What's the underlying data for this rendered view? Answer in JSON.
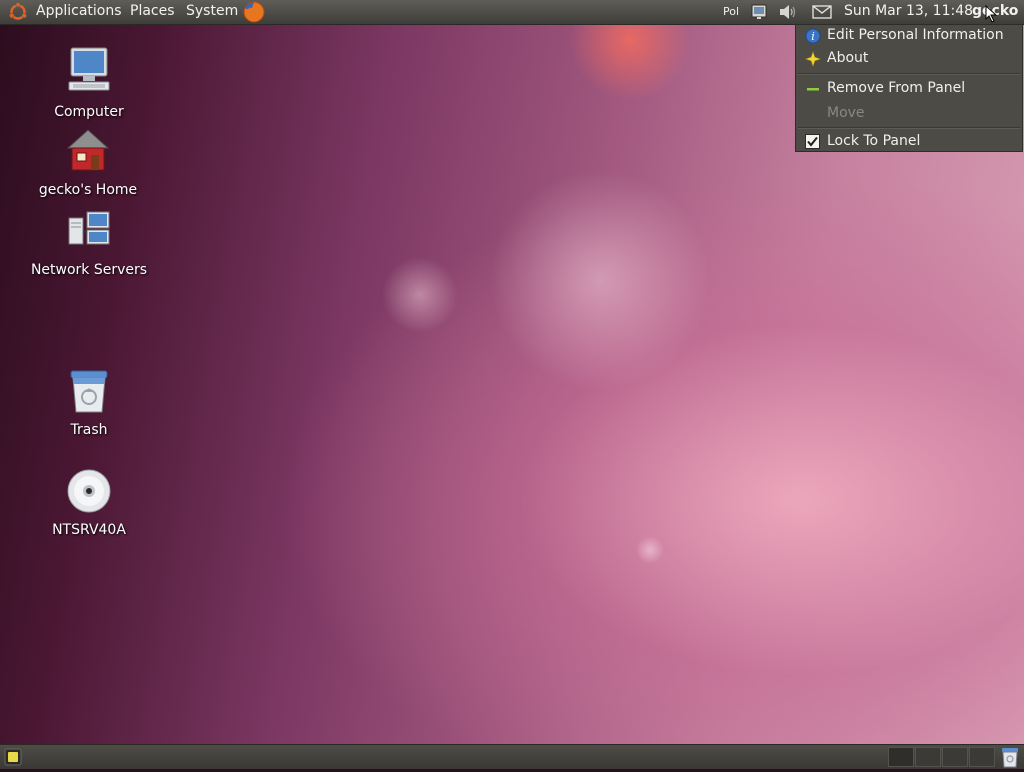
{
  "top_panel": {
    "menus": [
      "Applications",
      "Places",
      "System"
    ],
    "keyboard_layout": "Pol",
    "clock": "Sun Mar 13, 11:48",
    "user": "gecko"
  },
  "desktop": {
    "icons": [
      {
        "label": "Computer",
        "icon": "computer-icon"
      },
      {
        "label": "gecko's Home",
        "icon": "home-folder-icon"
      },
      {
        "label": "Network Servers",
        "icon": "network-servers-icon"
      },
      {
        "label": "Trash",
        "icon": "trash-icon"
      },
      {
        "label": "NTSRV40A",
        "icon": "cd-drive-icon"
      }
    ]
  },
  "context_menu": {
    "items": [
      {
        "label": "Edit Personal Information",
        "icon": "personal-info-icon",
        "enabled": true
      },
      {
        "label": "About",
        "icon": "about-star-icon",
        "enabled": true
      },
      {
        "label": "Remove From Panel",
        "icon": "remove-icon",
        "enabled": true
      },
      {
        "label": "Move",
        "icon": "",
        "enabled": false
      },
      {
        "label": "Lock To Panel",
        "icon": "checkbox-checked-icon",
        "enabled": true,
        "checked": true
      }
    ]
  },
  "bottom_panel": {
    "workspace_count": 4
  }
}
